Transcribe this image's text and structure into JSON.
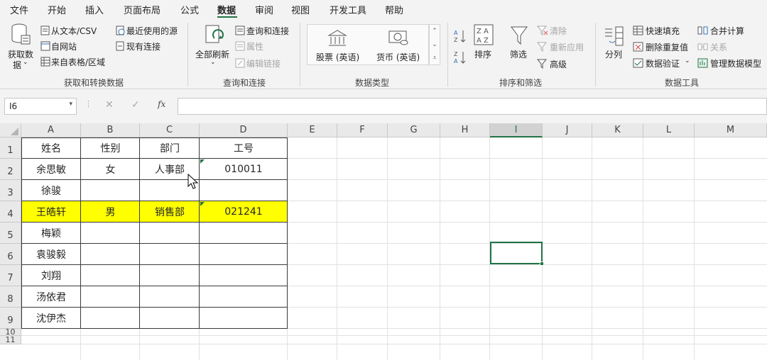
{
  "menu": {
    "items": [
      "文件",
      "开始",
      "插入",
      "页面布局",
      "公式",
      "数据",
      "审阅",
      "视图",
      "开发工具",
      "帮助"
    ],
    "active": "数据"
  },
  "ribbon": {
    "get_transform": {
      "get_data": "获取数",
      "get_data_line2": "据",
      "from_text_csv": "从文本/CSV",
      "from_web": "自网站",
      "from_table": "来自表格/区域",
      "recent_sources": "最近使用的源",
      "existing_connections": "现有连接",
      "label": "获取和转换数据"
    },
    "queries": {
      "refresh_all": "全部刷新",
      "queries_connections": "查询和连接",
      "properties": "属性",
      "edit_links": "编辑链接",
      "label": "查询和连接"
    },
    "data_types": {
      "stocks": "股票 (英语)",
      "currencies": "货币 (英语)",
      "label": "数据类型"
    },
    "sort_filter": {
      "sort": "排序",
      "filter": "筛选",
      "clear": "清除",
      "reapply": "重新应用",
      "advanced": "高级",
      "label": "排序和筛选"
    },
    "data_tools": {
      "text_to_columns": "分列",
      "flash_fill": "快速填充",
      "remove_duplicates": "删除重复值",
      "data_validation": "数据验证",
      "consolidate": "合并计算",
      "relationships": "关系",
      "manage_data_model": "管理数据模型",
      "label": "数据工具"
    }
  },
  "formula_bar": {
    "name_box": "I6",
    "fx": "fx",
    "formula": ""
  },
  "sheet": {
    "columns": [
      "A",
      "B",
      "C",
      "D",
      "E",
      "F",
      "G",
      "H",
      "I",
      "J",
      "K",
      "L",
      "M"
    ],
    "rows": [
      "1",
      "2",
      "3",
      "4",
      "5",
      "6",
      "7",
      "8",
      "9",
      "10",
      "11"
    ],
    "selected_column": "I",
    "table": {
      "headers": [
        "姓名",
        "性别",
        "部门",
        "工号"
      ],
      "rows": [
        [
          "余思敏",
          "女",
          "人事部",
          "010011"
        ],
        [
          "徐骏",
          "",
          "",
          ""
        ],
        [
          "王皓轩",
          "男",
          "销售部",
          "021241"
        ],
        [
          "梅颖",
          "",
          "",
          ""
        ],
        [
          "袁骏毅",
          "",
          "",
          ""
        ],
        [
          "刘翔",
          "",
          "",
          ""
        ],
        [
          "汤依君",
          "",
          "",
          ""
        ],
        [
          "沈伊杰",
          "",
          "",
          ""
        ]
      ]
    },
    "highlight_color": "#ffff00",
    "accent_color": "#217346"
  }
}
